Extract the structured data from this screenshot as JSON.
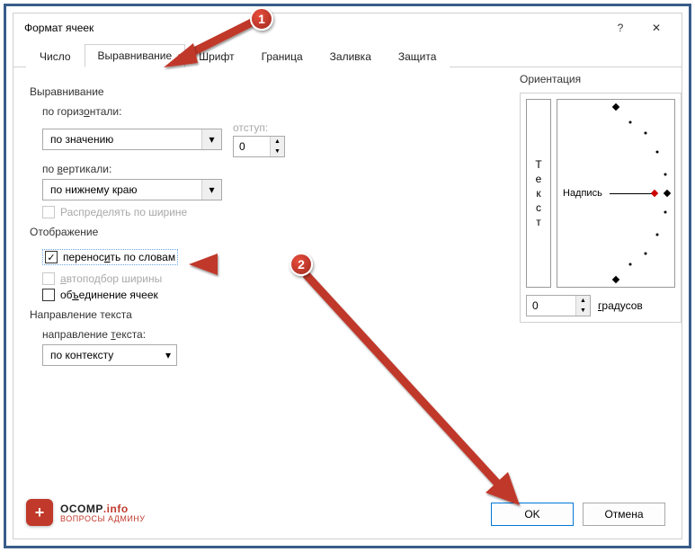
{
  "window": {
    "title": "Формат ячеек",
    "help_symbol": "?",
    "close_symbol": "✕"
  },
  "tabs": {
    "items": [
      {
        "label": "Число",
        "active": false
      },
      {
        "label": "Выравнивание",
        "active": true
      },
      {
        "label": "Шрифт",
        "active": false
      },
      {
        "label": "Граница",
        "active": false
      },
      {
        "label": "Заливка",
        "active": false
      },
      {
        "label": "Защита",
        "active": false
      }
    ]
  },
  "alignment": {
    "group_label": "Выравнивание",
    "horizontal_label": "по горизонтали:",
    "horizontal_value": "по значению",
    "indent_label": "отступ:",
    "indent_value": "0",
    "vertical_label": "по вертикали:",
    "vertical_value": "по нижнему краю",
    "distribute_label": "Распределять по ширине"
  },
  "display": {
    "group_label": "Отображение",
    "wrap_label": "переносить по словам",
    "wrap_checked": true,
    "shrink_label": "автоподбор ширины",
    "merge_label": "объединение ячеек"
  },
  "direction": {
    "group_label": "Направление текста",
    "label": "направление текста:",
    "value": "по контексту"
  },
  "orientation": {
    "group_label": "Ориентация",
    "vertical_word": "Текст",
    "dial_label": "Надпись",
    "degrees_value": "0",
    "degrees_label": "градусов"
  },
  "buttons": {
    "ok": "OK",
    "cancel": "Отмена"
  },
  "annotations": {
    "marker1": "1",
    "marker2": "2"
  },
  "logo": {
    "symbol": "+",
    "name_a": "OCOMP",
    "name_b": ".info",
    "tagline": "ВОПРОСЫ АДМИНУ"
  }
}
